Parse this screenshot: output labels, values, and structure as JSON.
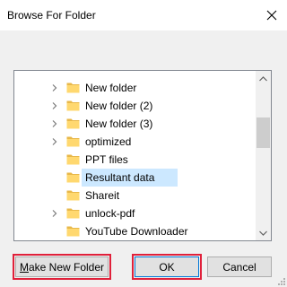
{
  "dialog": {
    "title": "Browse For Folder",
    "close_icon": "close-icon"
  },
  "tree": {
    "items": [
      {
        "label": "New folder",
        "expandable": true,
        "selected": false
      },
      {
        "label": "New folder (2)",
        "expandable": true,
        "selected": false
      },
      {
        "label": "New folder (3)",
        "expandable": true,
        "selected": false
      },
      {
        "label": "optimized",
        "expandable": true,
        "selected": false
      },
      {
        "label": "PPT files",
        "expandable": false,
        "selected": false
      },
      {
        "label": "Resultant data",
        "expandable": false,
        "selected": true
      },
      {
        "label": "Shareit",
        "expandable": false,
        "selected": false
      },
      {
        "label": "unlock-pdf",
        "expandable": true,
        "selected": false
      },
      {
        "label": "YouTube Downloader",
        "expandable": false,
        "selected": false
      }
    ]
  },
  "buttons": {
    "make_new_folder_access": "M",
    "make_new_folder_rest": "ake New Folder",
    "ok": "OK",
    "cancel": "Cancel"
  },
  "colors": {
    "selection": "#cce8ff",
    "highlight_border": "#e0203a",
    "folder_fill": "#ffd86f",
    "default_button_border": "#0078d7"
  }
}
